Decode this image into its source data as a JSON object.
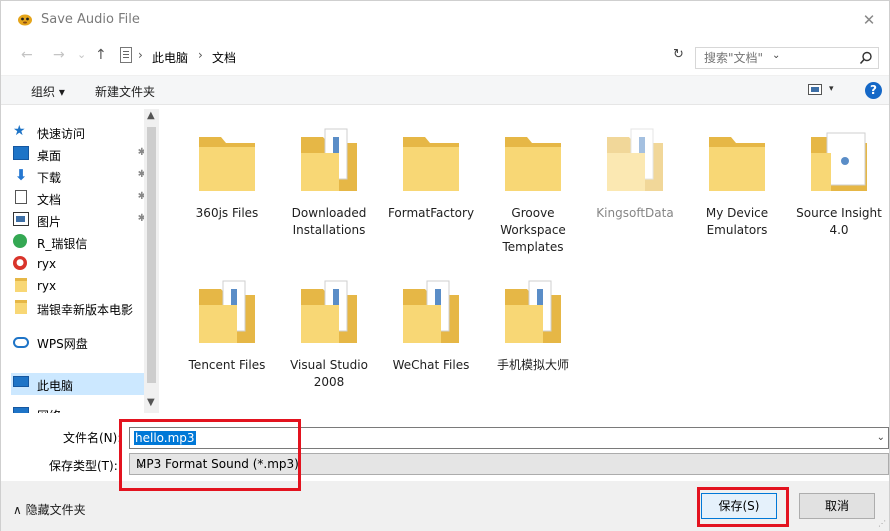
{
  "window": {
    "title": "Save Audio File",
    "close_glyph": "✕"
  },
  "nav": {
    "back": "←",
    "forward": "→",
    "recent": "⌄",
    "up": "↑"
  },
  "address": {
    "crumbs": [
      "此电脑",
      "文档"
    ],
    "sep": "›",
    "dropdown": "⌄",
    "refresh": "↻"
  },
  "search": {
    "placeholder": "搜索\"文档\""
  },
  "toolbar": {
    "organize": "组织 ▾",
    "new_folder": "新建文件夹",
    "view_dd": "▾",
    "help": "?"
  },
  "sidebar": {
    "items": [
      {
        "label": "快速访问",
        "icon": "star-icon"
      },
      {
        "label": "桌面",
        "icon": "desktop-icon",
        "pinned": true
      },
      {
        "label": "下载",
        "icon": "download-icon",
        "pinned": true
      },
      {
        "label": "文档",
        "icon": "document-icon",
        "pinned": true
      },
      {
        "label": "图片",
        "icon": "pictures-icon",
        "pinned": true
      },
      {
        "label": "R_瑞银信",
        "icon": "app-icon"
      },
      {
        "label": "ryx",
        "icon": "app-icon"
      },
      {
        "label": "ryx",
        "icon": "folder-icon"
      },
      {
        "label": "瑞银幸新版本电影",
        "icon": "folder-icon"
      },
      {
        "label": "WPS网盘",
        "icon": "cloud-icon"
      },
      {
        "label": "此电脑",
        "icon": "computer-icon",
        "selected": true
      },
      {
        "label": "网络",
        "icon": "network-icon"
      }
    ],
    "pin_glyph": "✱",
    "scroll_up": "▲",
    "scroll_down": "▼"
  },
  "folders": [
    {
      "name": "360js Files",
      "type": "plain"
    },
    {
      "name": "Downloaded Installations",
      "type": "docs"
    },
    {
      "name": "FormatFactory",
      "type": "plain"
    },
    {
      "name": "Groove Workspace Templates",
      "type": "plain"
    },
    {
      "name": "KingsoftData",
      "type": "faded"
    },
    {
      "name": "My Device Emulators",
      "type": "plain"
    },
    {
      "name": "Source Insight 4.0",
      "type": "sheet"
    },
    {
      "name": "Tencent Files",
      "type": "docs"
    },
    {
      "name": "Visual Studio 2008",
      "type": "docs"
    },
    {
      "name": "WeChat Files",
      "type": "docs"
    },
    {
      "name": "手机模拟大师",
      "type": "docs"
    }
  ],
  "file": {
    "name_label": "文件名(N):",
    "name_value": "hello.mp3",
    "type_label": "保存类型(T):",
    "type_value": "MP3 Format Sound (*.mp3)"
  },
  "footer": {
    "hide_folders": "∧ 隐藏文件夹",
    "save": "保存(S)",
    "cancel": "取消"
  },
  "colors": {
    "highlight": "#e3131f",
    "folder": "#f8d775",
    "selection": "#0078d7"
  }
}
